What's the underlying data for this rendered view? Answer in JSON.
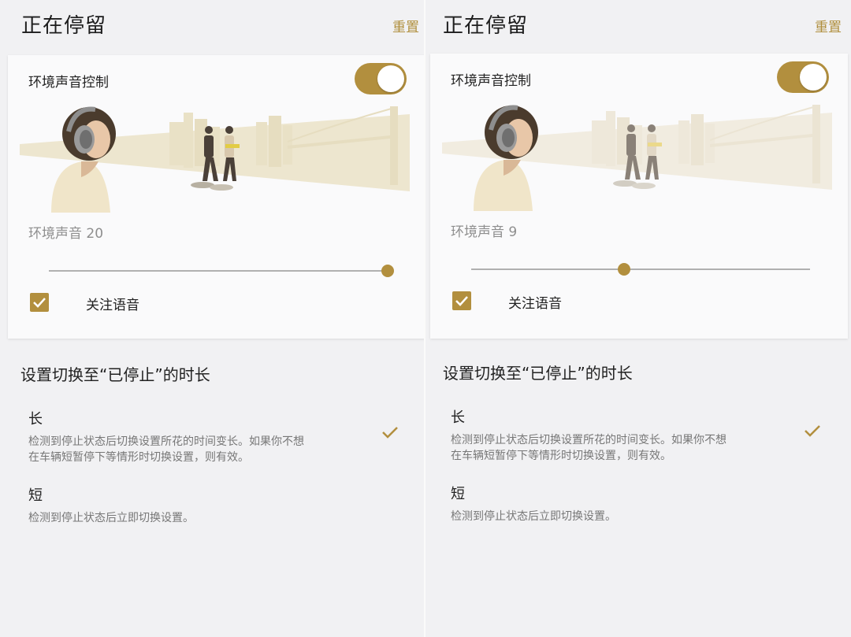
{
  "left": {
    "header": {
      "title": "正在停留",
      "reset_label": "重置"
    },
    "card": {
      "title": "环境声音控制",
      "toggle_on": true,
      "ambient_label": "环境声音 20",
      "ambient_level": 20,
      "attention_label": "关注语音",
      "attention_checked": true
    },
    "section": {
      "title": "设置切换至“已停止”的时长",
      "options": [
        {
          "title": "长",
          "desc_line1": "检测到停止状态后切换设置所花的时间变长。如果你不想",
          "desc_line2": "在车辆短暂停下等情形时切换设置，则有效。",
          "selected": true
        },
        {
          "title": "短",
          "desc_line1": "检测到停止状态后立即切换设置。",
          "desc_line2": "",
          "selected": false
        }
      ]
    }
  },
  "right": {
    "header": {
      "title": "正在停留",
      "reset_label": "重置"
    },
    "card": {
      "title": "环境声音控制",
      "toggle_on": true,
      "ambient_label": "环境声音 9",
      "ambient_level": 9,
      "attention_label": "关注语音",
      "attention_checked": true
    },
    "section": {
      "title": "设置切换至“已停止”的时长",
      "options": [
        {
          "title": "长",
          "desc_line1": "检测到停止状态后切换设置所花的时间变长。如果你不想",
          "desc_line2": "在车辆短暂停下等情形时切换设置，则有效。",
          "selected": true
        },
        {
          "title": "短",
          "desc_line1": "检测到停止状态后立即切换设置。",
          "desc_line2": "",
          "selected": false
        }
      ]
    }
  },
  "colors": {
    "accent": "#b28f3e",
    "background": "#f1f1f3",
    "card": "#fafafb"
  },
  "icons": [
    "check-icon",
    "headphones-icon"
  ]
}
